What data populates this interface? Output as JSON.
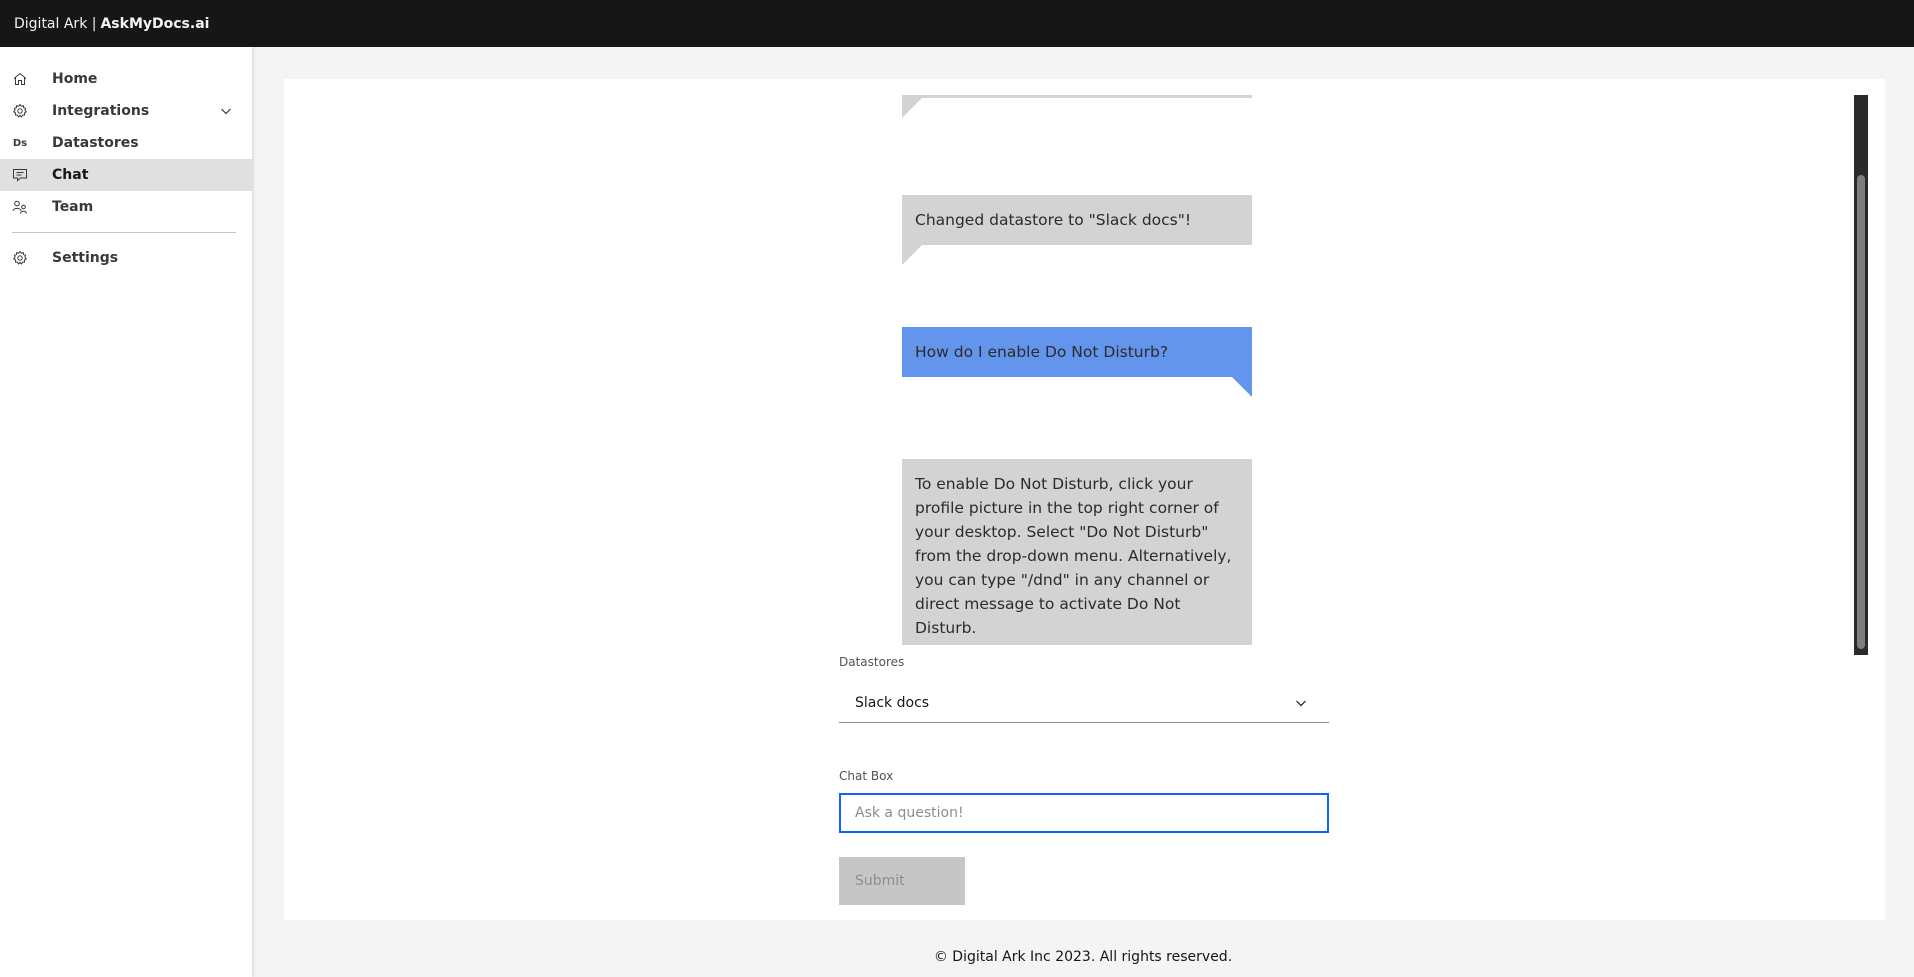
{
  "header": {
    "prefix": "Digital Ark |",
    "brand": "AskMyDocs.ai"
  },
  "sidebar": {
    "items": [
      {
        "label": "Home",
        "icon": "home-icon"
      },
      {
        "label": "Integrations",
        "icon": "gear-icon",
        "expandable": true
      },
      {
        "label": "Datastores",
        "icon": "ds-icon",
        "icon_text": "Ds"
      },
      {
        "label": "Chat",
        "icon": "chat-icon",
        "active": true
      },
      {
        "label": "Team",
        "icon": "team-icon"
      }
    ],
    "settings": {
      "label": "Settings",
      "icon": "gear-icon"
    }
  },
  "chat": {
    "messages": [
      {
        "role": "bot",
        "text": "Changed datastore to \"Slack docs\"!"
      },
      {
        "role": "user",
        "text": "How do I enable Do Not Disturb?"
      },
      {
        "role": "bot",
        "text": "To enable Do Not Disturb, click your profile picture in the top right corner of your desktop. Select \"Do Not Disturb\" from the drop-down menu. Alternatively, you can type \"/dnd\" in any channel or direct message to activate Do Not Disturb."
      }
    ],
    "datastores_label": "Datastores",
    "datastore_selected": "Slack docs",
    "chatbox_label": "Chat Box",
    "chatbox_placeholder": "Ask a question!",
    "chatbox_value": "",
    "submit_label": "Submit"
  },
  "footer": {
    "text": "© Digital Ark Inc 2023. All rights reserved."
  },
  "colors": {
    "header_bg": "#161616",
    "user_bubble": "#6495ed",
    "bot_bubble": "#d3d3d3",
    "focus": "#0f62fe",
    "active_nav": "#e0e0e0"
  }
}
